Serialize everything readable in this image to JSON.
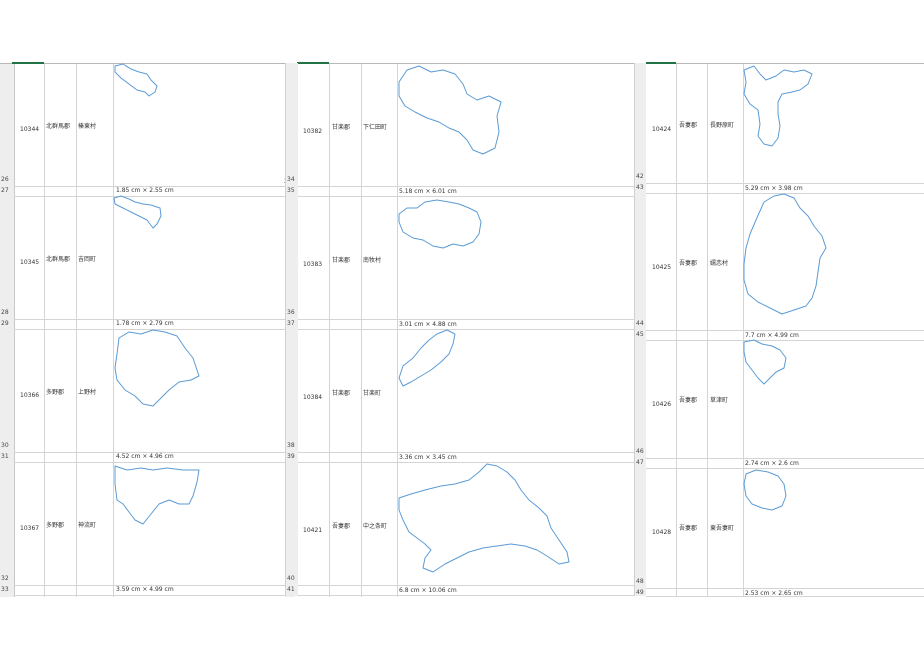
{
  "panels": [
    {
      "rows": [
        {
          "code": "10344",
          "district": "北群馬郡",
          "municipality": "榛東村",
          "size": "1.85 cm × 2.55 cm",
          "row_upper": "26",
          "row_lower": "27"
        },
        {
          "code": "10345",
          "district": "北群馬郡",
          "municipality": "吉岡町",
          "size": "1.78 cm × 2.79 cm",
          "row_upper": "28",
          "row_lower": "29"
        },
        {
          "code": "10366",
          "district": "多野郡",
          "municipality": "上野村",
          "size": "4.52 cm × 4.96 cm",
          "row_upper": "30",
          "row_lower": "31"
        },
        {
          "code": "10367",
          "district": "多野郡",
          "municipality": "神流町",
          "size": "3.59 cm × 4.99 cm",
          "row_upper": "32",
          "row_lower": "33"
        }
      ]
    },
    {
      "rows": [
        {
          "code": "10382",
          "district": "甘楽郡",
          "municipality": "下仁田町",
          "size": "5.18 cm × 6.01 cm",
          "row_upper": "34",
          "row_lower": "35"
        },
        {
          "code": "10383",
          "district": "甘楽郡",
          "municipality": "南牧村",
          "size": "3.01 cm × 4.88 cm",
          "row_upper": "36",
          "row_lower": "37"
        },
        {
          "code": "10384",
          "district": "甘楽郡",
          "municipality": "甘楽町",
          "size": "3.36 cm × 3.45 cm",
          "row_upper": "38",
          "row_lower": "39"
        },
        {
          "code": "10421",
          "district": "吾妻郡",
          "municipality": "中之条町",
          "size": "6.8 cm × 10.06 cm",
          "row_upper": "40",
          "row_lower": "41"
        }
      ]
    },
    {
      "rows": [
        {
          "code": "10424",
          "district": "吾妻郡",
          "municipality": "長野原町",
          "size": "5.29 cm × 3.98 cm",
          "row_upper": "42",
          "row_lower": "43"
        },
        {
          "code": "10425",
          "district": "吾妻郡",
          "municipality": "嬬恋村",
          "size": "7.7 cm × 4.99 cm",
          "row_upper": "44",
          "row_lower": "45"
        },
        {
          "code": "10426",
          "district": "吾妻郡",
          "municipality": "草津町",
          "size": "2.74 cm × 2.6 cm",
          "row_upper": "46",
          "row_lower": "47"
        },
        {
          "code": "10428",
          "district": "吾妻郡",
          "municipality": "東吾妻町",
          "size": "2.53 cm × 2.65 cm",
          "row_upper": "48",
          "row_lower": "49"
        }
      ]
    }
  ],
  "colors": {
    "outline": "#5b9bd5",
    "accent": "#217346",
    "header_bg": "#eeeeee",
    "gridline": "#d4d4d4"
  }
}
